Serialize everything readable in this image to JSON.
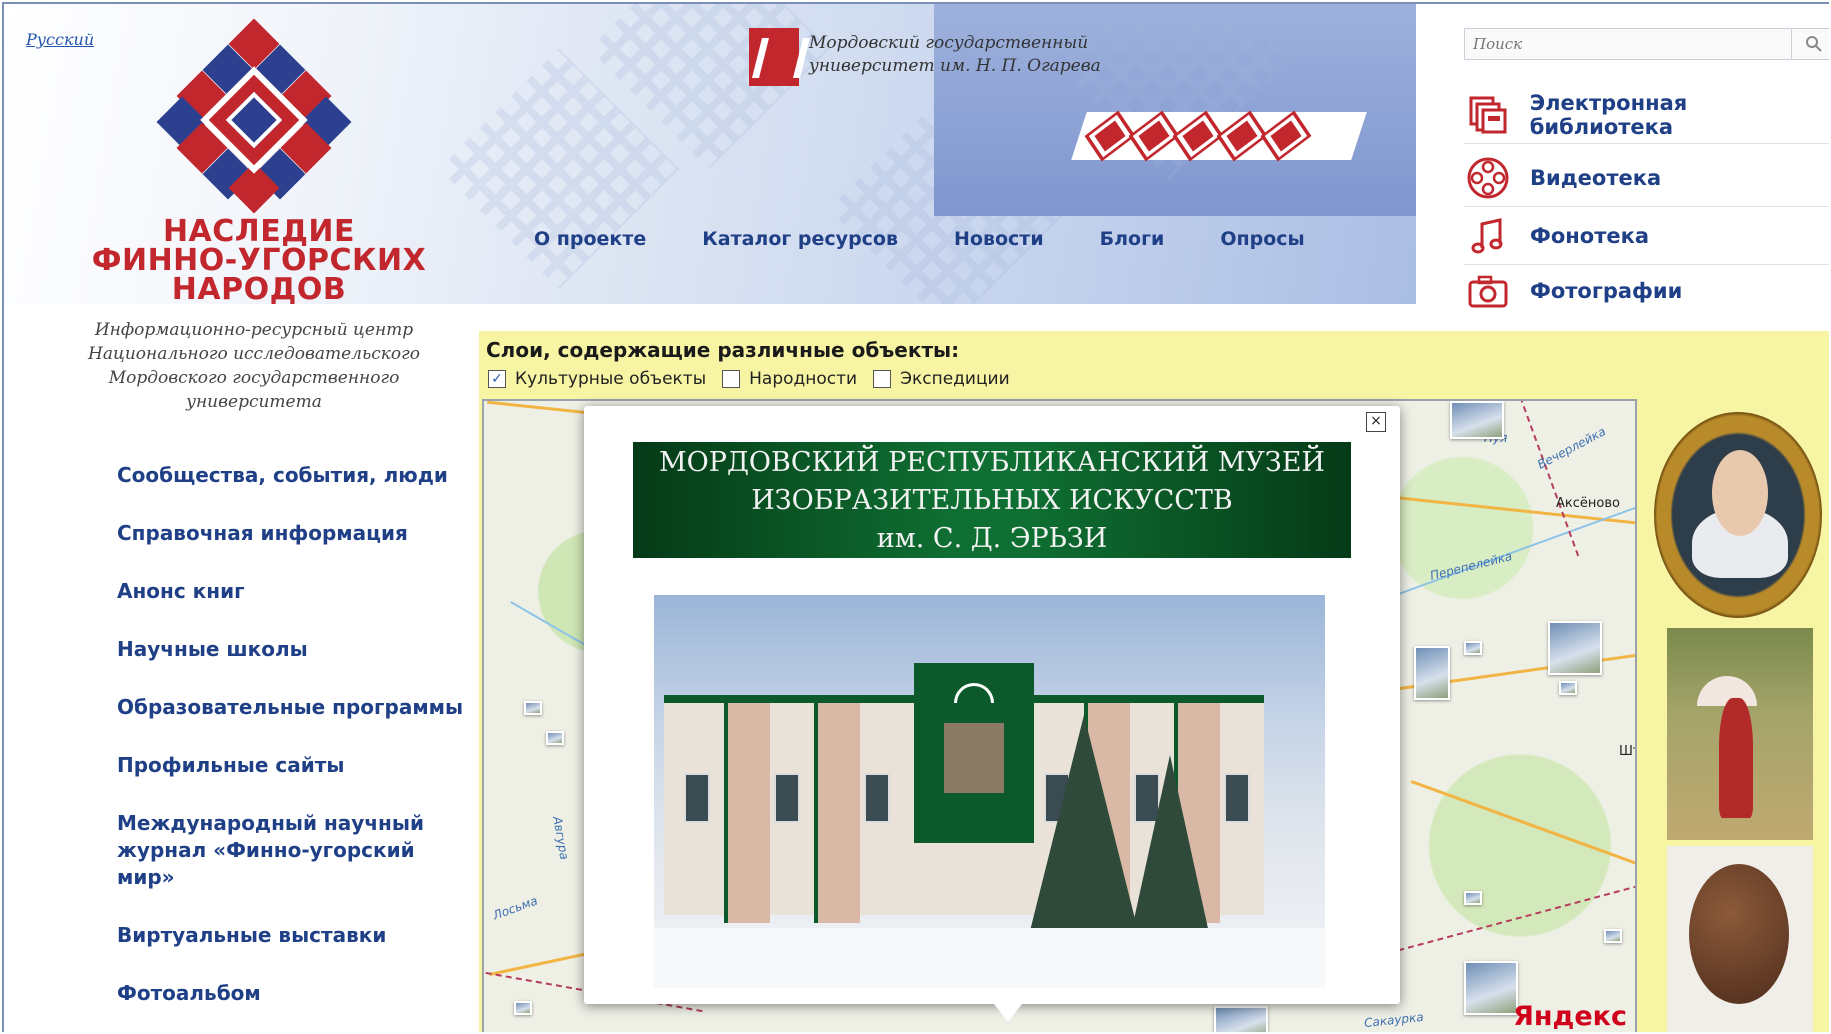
{
  "language_link": "Русский",
  "site": {
    "title": [
      "НАСЛЕДИЕ",
      "ФИННО-УГОРСКИХ",
      "НАРОДОВ"
    ],
    "subtitle": [
      "Информационно-ресурсный центр",
      "Национального исследовательского",
      "Мордовского государственного",
      "университета"
    ]
  },
  "university": [
    "Мордовский государственный",
    "университет им. Н. П. Огарева"
  ],
  "top_nav": [
    "О проекте",
    "Каталог ресурсов",
    "Новости",
    "Блоги",
    "Опросы"
  ],
  "search": {
    "placeholder": "Поиск"
  },
  "quick_links": [
    {
      "label": "Электронная библиотека",
      "icon": "library-icon"
    },
    {
      "label": "Видеотека",
      "icon": "film-reel-icon"
    },
    {
      "label": "Фонотека",
      "icon": "music-note-icon"
    },
    {
      "label": "Фотографии",
      "icon": "camera-icon"
    }
  ],
  "left_nav": [
    "Сообщества, события, люди",
    "Справочная информация",
    "Анонс книг",
    "Научные школы",
    "Образовательные программы",
    "Профильные сайты",
    "Международный научный журнал «Финно-угорский мир»",
    "Виртуальные выставки",
    "Фотоальбом"
  ],
  "layers": {
    "title": "Слои, содержащие различные объекты:",
    "options": [
      {
        "label": "Культурные объекты",
        "checked": true
      },
      {
        "label": "Народности",
        "checked": false
      },
      {
        "label": "Экспедиции",
        "checked": false
      }
    ]
  },
  "map": {
    "labels": [
      "Нуя",
      "Вечерлейка",
      "Перепелейка",
      "Аксёново",
      "Авгура",
      "Лосьма",
      "Сакаурка",
      "Шт"
    ],
    "provider": "Яндекс"
  },
  "popup": {
    "banner": [
      "МОРДОВСКИЙ РЕСПУБЛИКАНСКИЙ МУЗЕЙ",
      "ИЗОБРАЗИТЕЛЬНЫХ ИСКУССТВ",
      "им. С. Д. ЭРЬЗИ"
    ],
    "close": "×"
  },
  "colors": {
    "brand_red": "#c1272d",
    "link_blue": "#1f3f86",
    "panel_yellow": "#f7f5a4",
    "museum_green": "#0f6f32"
  }
}
